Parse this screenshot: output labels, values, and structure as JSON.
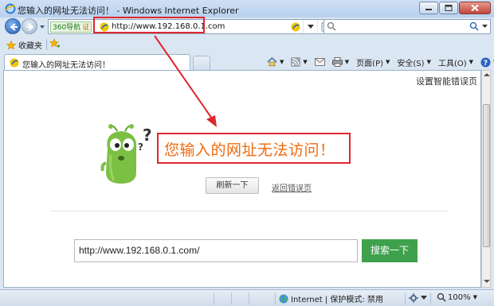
{
  "window": {
    "title": "您输入的网址无法访问！ - Windows Internet Explorer"
  },
  "addressbar": {
    "badge": "360导航",
    "badge_extra": "证",
    "url": "http://www.192.168.0.1.com"
  },
  "favorites": {
    "label": "收藏夹"
  },
  "tab": {
    "label": "您输入的网址无法访问！"
  },
  "commandbar": {
    "page": "页面(P)",
    "safety": "安全(S)",
    "tools": "工具(O)"
  },
  "page": {
    "settings_link": "设置智能错误页",
    "error_title": "您输入的网址无法访问！",
    "refresh_button": "刷新一下",
    "back_link": "返回错误页",
    "input_value": "http://www.192.168.0.1.com/",
    "search_button": "搜索一下"
  },
  "statusbar": {
    "zone": "Internet | 保护模式: 禁用",
    "zoom": "100%"
  },
  "colors": {
    "error_title": "#ef6b0f",
    "search_button": "#3fa14d",
    "highlight": "#e0262d",
    "mascot": "#7bc043"
  }
}
